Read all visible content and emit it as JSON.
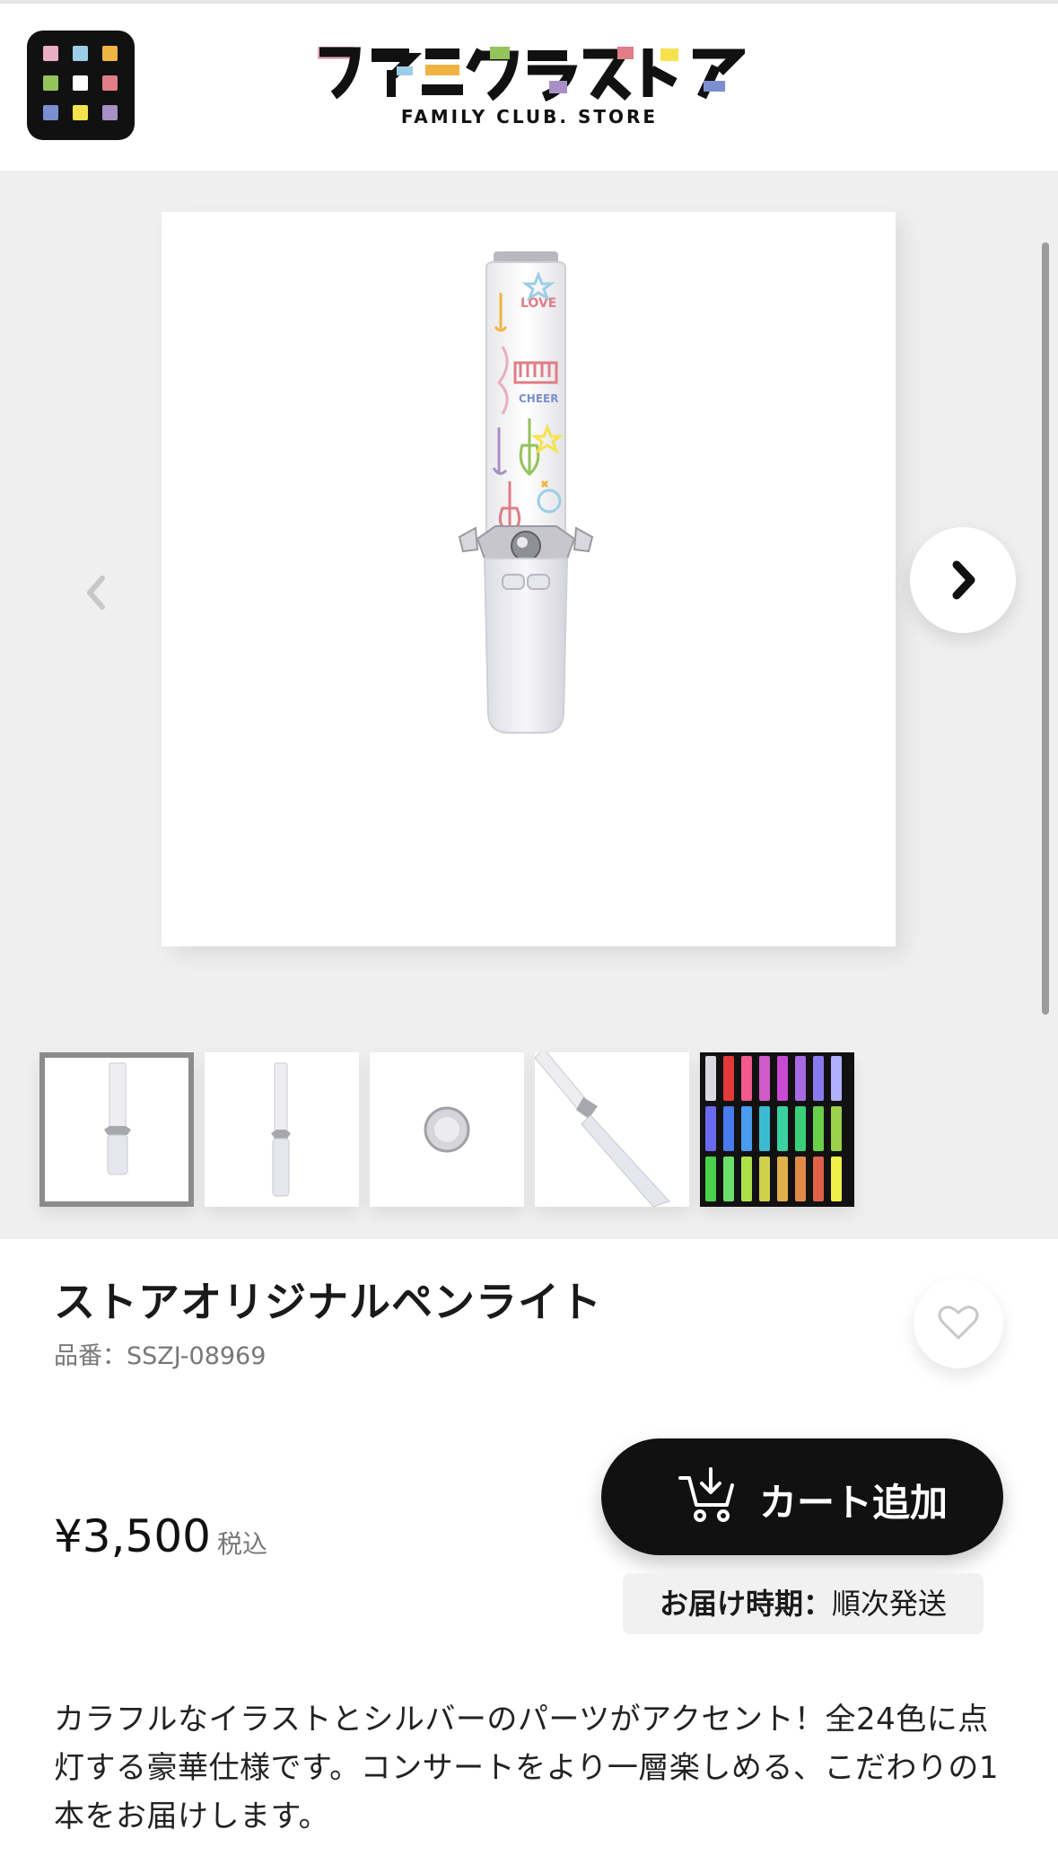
{
  "header": {
    "logo_text": "ファミクラストア",
    "logo_subtitle": "FAMILY CLUB. STORE"
  },
  "product": {
    "title": "ストアオリジナルペンライト",
    "code_label": "品番：",
    "code": "SSZJ-08969",
    "price": "¥3,500",
    "tax_label": "税込",
    "cart_label": "カート追加",
    "delivery_label": "お届け時期：",
    "delivery_value": "順次発送",
    "description": "カラフルなイラストとシルバーのパーツがアクセント！全24色に点灯する豪華仕様です。コンサートをより一層楽しめる、こだわりの1本をお届けします。"
  },
  "gallery": {
    "main_image_alt": "penlight",
    "thumbnails": [
      "penlight-front",
      "penlight-side",
      "penlight-cap",
      "penlight-angle",
      "penlight-24-colors"
    ]
  },
  "colors": {
    "app_icon_tiles": [
      "#e9aec4",
      "#9dcde6",
      "#f0b443",
      "#93c35a",
      "#ffffff",
      "#e07d86",
      "#7b8fd0",
      "#f5e24d",
      "#a88fc6"
    ],
    "accent": "#111111"
  },
  "icons": [
    "app-grid-icon",
    "chevron-left-icon",
    "chevron-right-icon",
    "heart-icon",
    "cart-icon"
  ]
}
